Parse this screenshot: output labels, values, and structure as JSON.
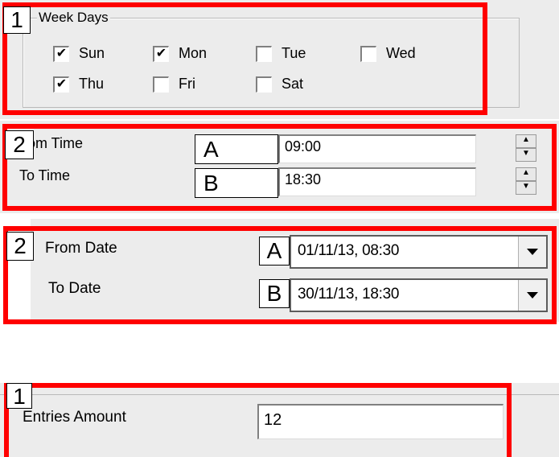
{
  "callouts": {
    "week_days": "1",
    "time_range": "2",
    "from_time_input": "A",
    "to_time_input": "B",
    "date_range": "2",
    "from_date_input": "A",
    "to_date_input": "B",
    "entries": "1"
  },
  "week_days": {
    "legend": "Week Days",
    "days": [
      {
        "label": "Sun",
        "checked": true
      },
      {
        "label": "Mon",
        "checked": true
      },
      {
        "label": "Tue",
        "checked": false
      },
      {
        "label": "Wed",
        "checked": false
      },
      {
        "label": "Thu",
        "checked": true
      },
      {
        "label": "Fri",
        "checked": false
      },
      {
        "label": "Sat",
        "checked": false
      }
    ]
  },
  "time_range": {
    "from_label": "om Time",
    "from_value": "09:00",
    "to_label": "To Time",
    "to_value": "18:30"
  },
  "date_range": {
    "from_label": "From Date",
    "from_value": "01/11/13, 08:30",
    "to_label": "To Date",
    "to_value": "30/11/13, 18:30"
  },
  "entries": {
    "label": "Entries Amount",
    "value": "12"
  },
  "colors": {
    "highlight": "#ff0000",
    "panel": "#ececec"
  }
}
